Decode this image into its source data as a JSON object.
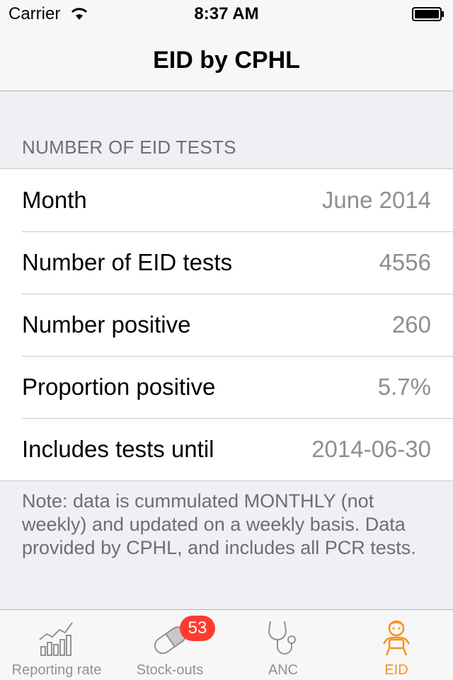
{
  "status_bar": {
    "carrier": "Carrier",
    "time": "8:37 AM"
  },
  "nav": {
    "title": "EID by CPHL"
  },
  "section": {
    "header": "NUMBER OF EID TESTS"
  },
  "rows": [
    {
      "label": "Month",
      "value": "June 2014"
    },
    {
      "label": "Number of EID tests",
      "value": "4556"
    },
    {
      "label": "Number positive",
      "value": "260"
    },
    {
      "label": "Proportion positive",
      "value": "5.7%"
    },
    {
      "label": "Includes tests until",
      "value": "2014-06-30"
    }
  ],
  "note": "Note: data is cummulated MONTHLY (not weekly) and updated on a weekly basis. Data provided by CPHL, and includes all PCR tests.",
  "tabs": [
    {
      "label": "Reporting rate",
      "icon": "bar-chart-icon",
      "active": false
    },
    {
      "label": "Stock-outs",
      "icon": "pill-icon",
      "badge": "53",
      "active": false
    },
    {
      "label": "ANC",
      "icon": "stethoscope-icon",
      "active": false
    },
    {
      "label": "EID",
      "icon": "baby-icon",
      "active": true
    }
  ],
  "colors": {
    "accent": "#f7931e",
    "badge": "#ff3b30",
    "inactive_tab": "#929292"
  }
}
